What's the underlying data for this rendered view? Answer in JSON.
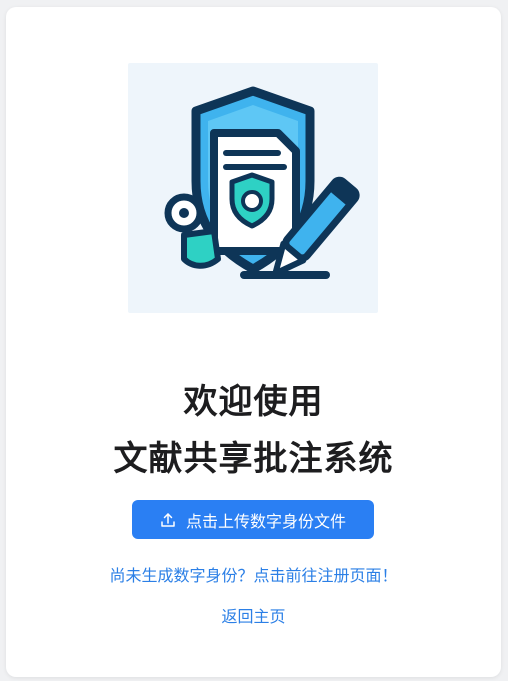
{
  "header": {
    "title_line1": "欢迎使用",
    "title_line2": "文献共享批注系统"
  },
  "actions": {
    "upload_label": "点击上传数字身份文件",
    "register_link": "尚未生成数字身份？点击前往注册页面！",
    "home_link": "返回主页"
  },
  "icons": {
    "logo": "shield-document-pen-icon",
    "upload": "upload-icon"
  },
  "colors": {
    "accent": "#2a7ff3",
    "link": "#2b7fe6",
    "title": "#1d1d1f",
    "background": "#f0f1f3"
  }
}
